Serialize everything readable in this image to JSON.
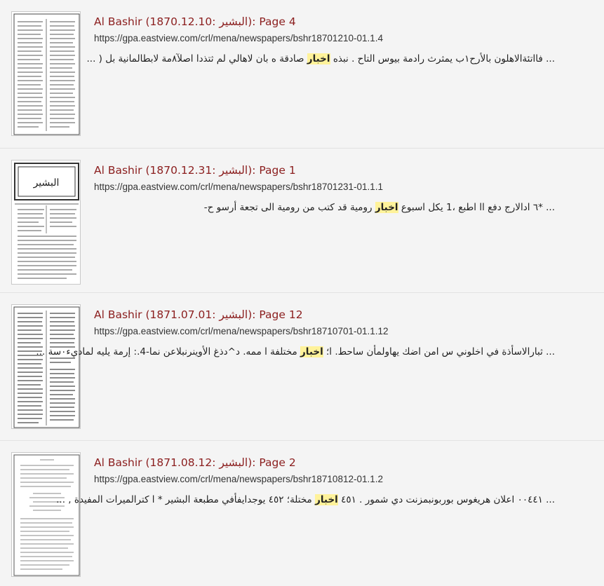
{
  "colors": {
    "title": "#8b1e1e",
    "highlight": "#fff29a",
    "background": "#f4f4f4"
  },
  "results": [
    {
      "title": "Al Bashir (البشير :1870.12.10): Page 4",
      "url": "https://gpa.eastview.com/crl/mena/newspapers/bshr18701210-01.1.4",
      "snippet_before": "... فااتئةالاهلون بالأرح١ب يمثرث رادمة بيوس التاح . نبذه",
      "snippet_highlight": "اخبار",
      "snippet_after": "صادقة ه بان لاهالي لم ثتذدا اصلآ٨مة لابطالمانية بل ( ..."
    },
    {
      "title": "Al Bashir (البشير :1870.12.31): Page 1",
      "url": "https://gpa.eastview.com/crl/mena/newspapers/bshr18701231-01.1.1",
      "snippet_before": "... *٦ ادالارج دفع اا اطبع ،1 يكل اسبوع",
      "snippet_highlight": "اخبار",
      "snippet_after": "رومية قد كتب من رومية الى تجعة أرسو ح-"
    },
    {
      "title": "Al Bashir (البشير :1871.07.01): Page 12",
      "url": "https://gpa.eastview.com/crl/mena/newspapers/bshr18710701-01.1.12",
      "snippet_before": "... ثبارالاسأذة في اخلوني س امن اضك يهاولمأن ساحط. ا؛",
      "snippet_highlight": "اخبار",
      "snippet_after": "مختلفة ا ممه. د^دذغ الأوينرنبلاعن نما-4.: إرمة يليه لماديء٠سة ..."
    },
    {
      "title": "Al Bashir (البشير :1871.08.12): Page 2",
      "url": "https://gpa.eastview.com/crl/mena/newspapers/bshr18710812-01.1.2",
      "snippet_before": "... ٠٠٤٤١ lعلان هريغوس بوربونبمزنت دي شمور . ٤٥١",
      "snippet_highlight": "اخبار",
      "snippet_after": "مختلة؛ ٤٥٢ يوجدايفأفي مطبعة البشير * ا كترالميرات المفيدة , ..."
    }
  ]
}
